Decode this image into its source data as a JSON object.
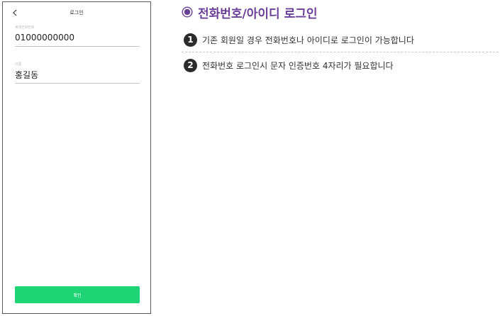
{
  "phone": {
    "title": "로그인",
    "phone_field": {
      "label": "휴대전화번호",
      "value": "01000000000"
    },
    "name_field": {
      "label": "이름",
      "value": "홍길동"
    },
    "confirm_label": "확인",
    "accent_color": "#1fd475"
  },
  "description": {
    "title": "전화번호/아이디 로그인",
    "title_color": "#6a3f98",
    "steps": [
      {
        "number": "1",
        "text": "기존 회원일 경우 전화번호나 아이디로 로그인이 가능합니다"
      },
      {
        "number": "2",
        "text": "전화번호 로그인시 문자 인증번호 4자리가 필요합니다"
      }
    ]
  },
  "icons": {
    "back": "chevron-left-icon",
    "title_bullet": "radio-bullet-icon"
  }
}
